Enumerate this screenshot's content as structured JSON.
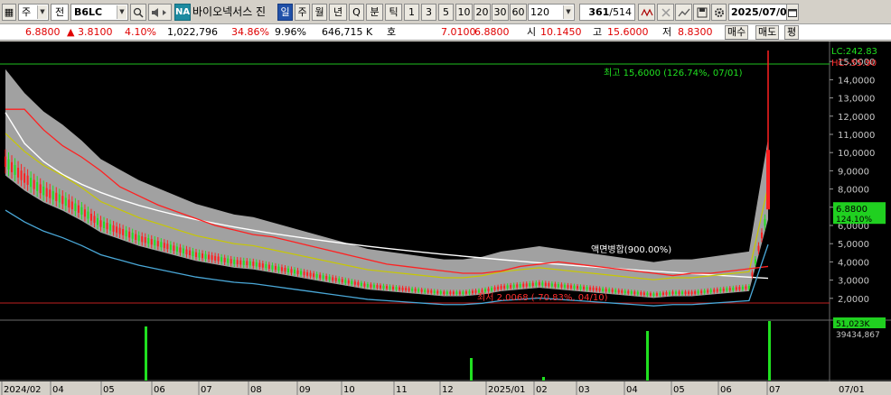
{
  "toolbar": {
    "market_select": "주",
    "mode_select": "전",
    "ticker": "B6LC",
    "search_icon": "search-icon",
    "speaker_icon": "speaker-icon",
    "na_badge": "NA",
    "company_name": "바이오넥서스 진",
    "period_tabs": [
      "일",
      "주",
      "월",
      "년",
      "Q",
      "분",
      "틱"
    ],
    "active_period": "일",
    "interval_tabs": [
      "1",
      "3",
      "5",
      "10",
      "20",
      "30",
      "60",
      "120"
    ],
    "count_value": "361",
    "count_total": "/514",
    "date_value": "2025/07/0"
  },
  "quote": {
    "price": "6.8800",
    "change_arrow": "▲",
    "change": "3.8100",
    "change_pct": "4.10%",
    "volume": "1,022,796",
    "volume_ratio": "34.86%",
    "turnover": "9.96%",
    "amount": "646,715 K",
    "ask_label": "호",
    "ask_value": "7.0100",
    "bid_value": "6.8800",
    "open_label": "시",
    "open_value": "10.1450",
    "high_label": "고",
    "high_value": "15.6000",
    "low_label": "저",
    "low_value": "8.8300",
    "buy_button": "매수",
    "sell_button": "매도",
    "eval_button": "평"
  },
  "chart_data": {
    "type": "candlestick",
    "annotations": {
      "high_marker": "최고 15,6000 (126.74%, 07/01)",
      "low_marker": "최저 2,0068 (-70.83%, 04/10)",
      "mid_label": "액면병합(900.00%)",
      "lc_label": "LC:242.83",
      "hc_label": "HC:-55.90"
    },
    "y_axis_ticks": [
      "15,0000",
      "14,0000",
      "13,0000",
      "12,0000",
      "11,0000",
      "10,0000",
      "9,0000",
      "8,0000",
      "7,0000",
      "6,0000",
      "5,0000",
      "4,0000",
      "3,0000",
      "2,0000"
    ],
    "y_range": [
      1.0,
      15.9
    ],
    "current_price_tag": "6.8800",
    "current_pct_tag": "124.10%",
    "volume_tags": [
      "51,023K",
      "39434,867"
    ],
    "x_axis_labels": [
      "2024/02",
      "04",
      "05",
      "06",
      "07",
      "08",
      "09",
      "10",
      "11",
      "12",
      "2025/01",
      "02",
      "03",
      "04",
      "05",
      "06",
      "07",
      "07/01"
    ],
    "colors": {
      "up": "#ff2020",
      "down": "#20e020",
      "ma_long": "#ffffff",
      "ma_mid": "#c8c800",
      "ma_red": "#ff2020",
      "ma_blue": "#4aa8d8",
      "cloud": "#bdbdbd",
      "reference": "#20c020"
    },
    "series": [
      {
        "name": "close",
        "values": [
          9.5,
          8.6,
          7.9,
          7.4,
          6.8,
          6.1,
          5.7,
          5.3,
          5.0,
          4.7,
          4.4,
          4.2,
          4.0,
          3.9,
          3.7,
          3.5,
          3.3,
          3.1,
          2.9,
          2.7,
          2.6,
          2.5,
          2.4,
          2.3,
          2.3,
          2.4,
          2.6,
          2.7,
          2.8,
          2.7,
          2.6,
          2.5,
          2.4,
          2.3,
          2.2,
          2.3,
          2.3,
          2.4,
          2.5,
          2.6,
          6.88
        ]
      }
    ]
  }
}
